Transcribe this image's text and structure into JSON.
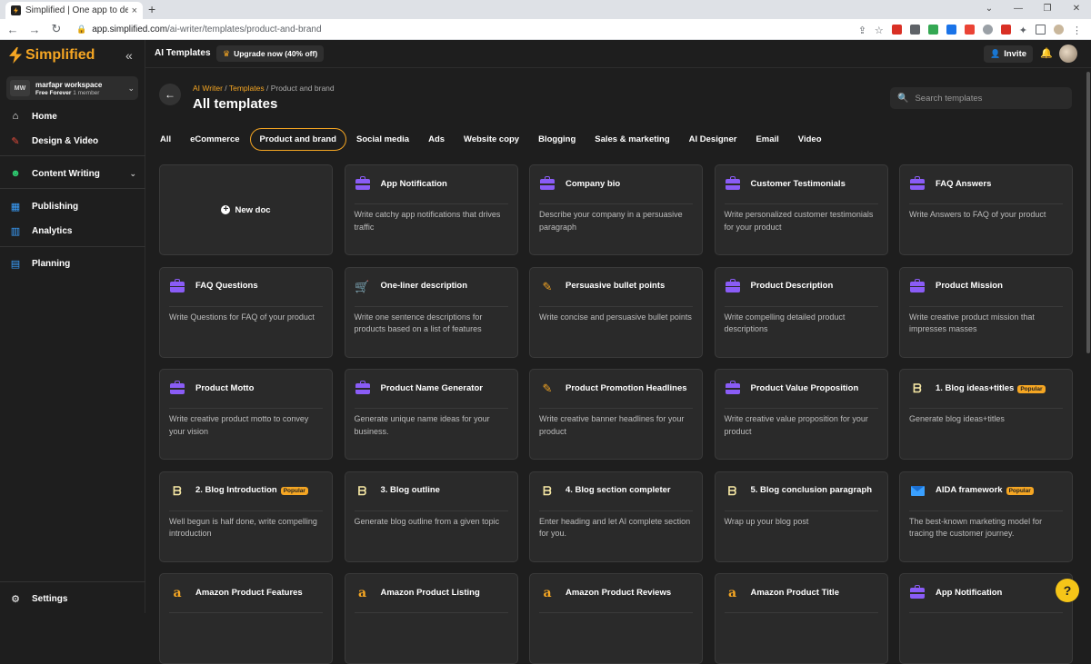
{
  "browser": {
    "tab_title": "Simplified | One app to design, c",
    "tab_close": "×",
    "new_tab": "+",
    "url_host": "app.simplified.com",
    "url_path": "/ai-writer/templates/product-and-brand",
    "window_controls": [
      "⌄",
      "—",
      "❐",
      "✕"
    ]
  },
  "sidebar": {
    "logo": "Simplified",
    "collapse": "«",
    "workspace": {
      "initials": "MW",
      "name": "marfapr workspace",
      "plan": "Free Forever",
      "members": "1 member"
    },
    "items": [
      {
        "label": "Home",
        "icon": "home-icon",
        "glyph": "⌂"
      },
      {
        "label": "Design & Video",
        "icon": "design-icon",
        "glyph": "✎"
      },
      {
        "label": "Content Writing",
        "icon": "robot-icon",
        "glyph": "☻"
      },
      {
        "label": "Publishing",
        "icon": "calendar-icon",
        "glyph": "▦"
      },
      {
        "label": "Analytics",
        "icon": "chart-icon",
        "glyph": "▥"
      },
      {
        "label": "Planning",
        "icon": "clipboard-icon",
        "glyph": "▤"
      },
      {
        "label": "Settings",
        "icon": "gear-icon",
        "glyph": "⚙"
      }
    ],
    "colors": {
      "home": "#ffffff",
      "design": "#e74c3c",
      "content": "#2ecc71",
      "publishing": "#3aa0ff",
      "analytics": "#3aa0ff",
      "planning": "#3aa0ff"
    }
  },
  "header": {
    "title": "AI Templates",
    "upgrade": "Upgrade now (40% off)",
    "invite": "Invite"
  },
  "main": {
    "breadcrumb": {
      "root": "AI Writer",
      "sep": " / ",
      "mid": "Templates",
      "current": "Product and brand"
    },
    "title": "All templates",
    "search_placeholder": "Search templates",
    "categories": [
      "All",
      "eCommerce",
      "Product and brand",
      "Social media",
      "Ads",
      "Website copy",
      "Blogging",
      "Sales & marketing",
      "AI Designer",
      "Email",
      "Video"
    ],
    "active_category": "Product and brand",
    "new_doc": "New doc",
    "cards": [
      {
        "name": "App Notification",
        "desc": "Write catchy app notifications that drives traffic",
        "icon": "briefcase"
      },
      {
        "name": "Company bio",
        "desc": "Describe your company in a persuasive paragraph",
        "icon": "briefcase"
      },
      {
        "name": "Customer Testimonials",
        "desc": "Write personalized customer testimonials for your product",
        "icon": "briefcase"
      },
      {
        "name": "FAQ Answers",
        "desc": "Write Answers to FAQ of your product",
        "icon": "briefcase"
      },
      {
        "name": "FAQ Questions",
        "desc": "Write Questions for FAQ of your product",
        "icon": "briefcase"
      },
      {
        "name": "One-liner description",
        "desc": "Write one sentence descriptions for products based on a list of features",
        "icon": "cart"
      },
      {
        "name": "Persuasive bullet points",
        "desc": "Write concise and persuasive bullet points",
        "icon": "pencil"
      },
      {
        "name": "Product Description",
        "desc": "Write compelling detailed product descriptions",
        "icon": "briefcase"
      },
      {
        "name": "Product Mission",
        "desc": "Write creative product mission that impresses masses",
        "icon": "briefcase"
      },
      {
        "name": "Product Motto",
        "desc": "Write creative product motto to convey your vision",
        "icon": "briefcase"
      },
      {
        "name": "Product Name Generator",
        "desc": "Generate unique name ideas for your business.",
        "icon": "briefcase"
      },
      {
        "name": "Product Promotion Headlines",
        "desc": "Write creative banner headlines for your product",
        "icon": "pencil"
      },
      {
        "name": "Product Value Proposition",
        "desc": "Write creative value proposition for your product",
        "icon": "briefcase"
      },
      {
        "name": "1. Blog ideas+titles",
        "desc": "Generate blog ideas+titles",
        "icon": "blog",
        "badge": "Popular"
      },
      {
        "name": "2. Blog Introduction",
        "desc": "Well begun is half done, write compelling introduction",
        "icon": "blog",
        "badge": "Popular"
      },
      {
        "name": "3. Blog outline",
        "desc": "Generate blog outline from a given topic",
        "icon": "blog"
      },
      {
        "name": "4. Blog section completer",
        "desc": "Enter heading and let AI complete section for you.",
        "icon": "blog"
      },
      {
        "name": "5. Blog conclusion paragraph",
        "desc": "Wrap up your blog post",
        "icon": "blog"
      },
      {
        "name": "AIDA framework",
        "desc": "The best-known marketing model for tracing the customer journey.",
        "icon": "mail",
        "badge": "Popular"
      },
      {
        "name": "Amazon Product Features",
        "desc": "",
        "icon": "amazon"
      },
      {
        "name": "Amazon Product Listing",
        "desc": "",
        "icon": "amazon"
      },
      {
        "name": "Amazon Product Reviews",
        "desc": "",
        "icon": "amazon"
      },
      {
        "name": "Amazon Product Title",
        "desc": "",
        "icon": "amazon"
      },
      {
        "name": "App Notification",
        "desc": "",
        "icon": "briefcase"
      }
    ],
    "help": "?"
  },
  "colors": {
    "accent": "#f5a623",
    "bg": "#1e1e1e",
    "card": "#2a2a2a"
  }
}
